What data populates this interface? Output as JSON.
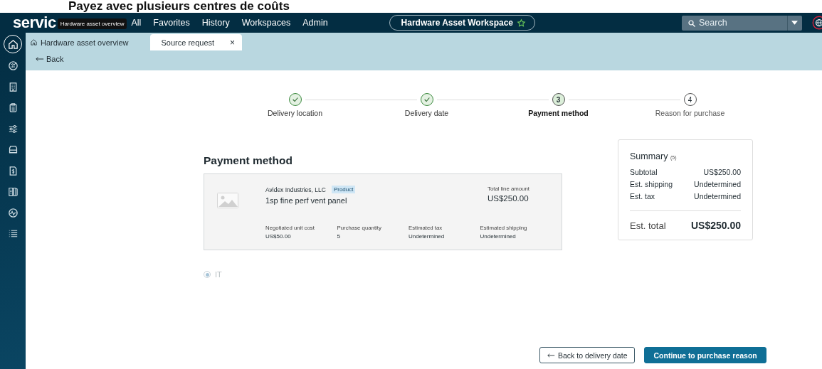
{
  "caption": "Payez avec plusieurs centres de coûts",
  "top_nav": {
    "logo": "servic",
    "tooltip": "Hardware asset overview",
    "items": [
      "All",
      "Favorites",
      "History",
      "Workspaces",
      "Admin"
    ],
    "workspace": {
      "title": "Hardware Asset Workspace",
      "favorite": true
    },
    "search": {
      "placeholder": "Search"
    }
  },
  "sidebar": {
    "items": [
      {
        "kind": "home",
        "selected": true
      },
      {
        "kind": "dashboard",
        "selected": false
      },
      {
        "kind": "building",
        "selected": false
      },
      {
        "kind": "clipboard",
        "selected": false
      },
      {
        "kind": "sliders",
        "selected": false
      },
      {
        "kind": "drive",
        "selected": false
      },
      {
        "kind": "invoice",
        "selected": false
      },
      {
        "kind": "book",
        "selected": false
      },
      {
        "kind": "pulse",
        "selected": false
      },
      {
        "kind": "list",
        "selected": false
      }
    ]
  },
  "tabs": [
    {
      "label": "Hardware asset overview",
      "kind": "home",
      "selected": false
    },
    {
      "label": "Source request",
      "kind": "record",
      "selected": true,
      "close": "×"
    }
  ],
  "back_link": "Back",
  "steps": [
    {
      "label": "Delivery location",
      "completed": true,
      "selected": false
    },
    {
      "label": "Delivery date",
      "completed": true,
      "selected": false
    },
    {
      "label": "Payment method",
      "number": "3",
      "completed": false,
      "selected": true
    },
    {
      "label": "Reason for purchase",
      "number": "4",
      "completed": false,
      "selected": false
    }
  ],
  "page_title": "Payment method",
  "line_item": {
    "supplier": "Avidex Industries, LLC",
    "tag": "Product",
    "name": "1sp fine perf vent panel",
    "total_label": "Total line amount",
    "total": "US$250.00",
    "fields": [
      {
        "label": "Negotiated unit cost",
        "value": "US$50.00"
      },
      {
        "label": "Purchase quantity",
        "value": "5"
      },
      {
        "label": "Estimated tax",
        "value": "Undetermined"
      },
      {
        "label": "Estimated shipping",
        "value": "Undetermined"
      }
    ]
  },
  "cost_centers": [
    {
      "label": "IT",
      "selected": true,
      "disabled": true
    }
  ],
  "summary": {
    "title": "Summary",
    "count": "(5)",
    "rows": [
      {
        "label": "Subtotal",
        "value": "US$250.00"
      },
      {
        "label": "Est. shipping",
        "value": "Undetermined"
      },
      {
        "label": "Est. tax",
        "value": "Undetermined"
      }
    ],
    "total_label": "Est. total",
    "total": "US$250.00"
  },
  "buttons": [
    {
      "label": "Back to delivery date",
      "kind": "secondary"
    },
    {
      "label": "Continue to purchase reason",
      "kind": "primary"
    }
  ]
}
